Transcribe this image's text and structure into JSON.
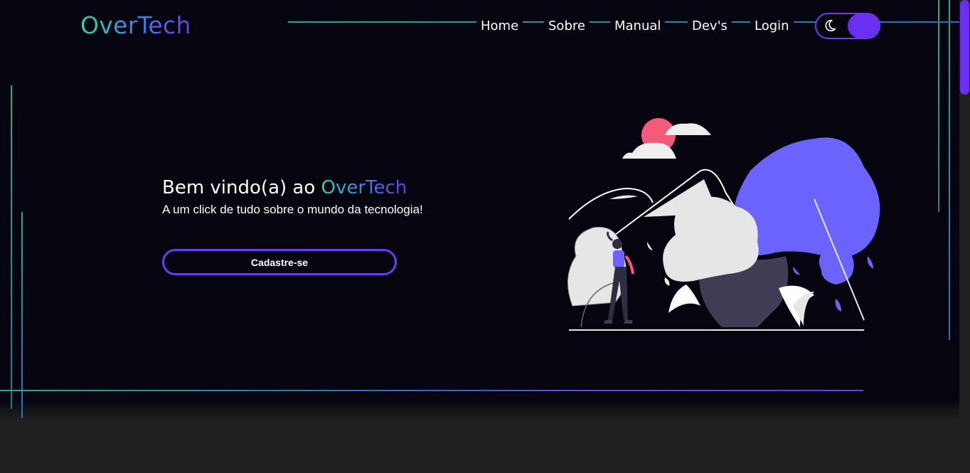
{
  "brand": {
    "logo": "OverTech"
  },
  "nav": {
    "items": [
      {
        "label": "Home"
      },
      {
        "label": "Sobre"
      },
      {
        "label": "Manual"
      },
      {
        "label": "Dev's"
      },
      {
        "label": "Login"
      }
    ]
  },
  "theme_toggle": {
    "icon": "moon-icon",
    "state": "dark"
  },
  "hero": {
    "welcome_prefix": "Bem vindo(a) ao ",
    "welcome_brand": "OverTech",
    "tagline": "A um click de tudo sobre o mundo da tecnologia!",
    "cta_label": "Cadastre-se"
  },
  "colors": {
    "background": "#05040f",
    "footer": "#202020",
    "accent_purple": "#6a2ff0",
    "accent_teal": "#1fae8a",
    "illustration_blue": "#6c63ff",
    "sun": "#f45b7a"
  }
}
